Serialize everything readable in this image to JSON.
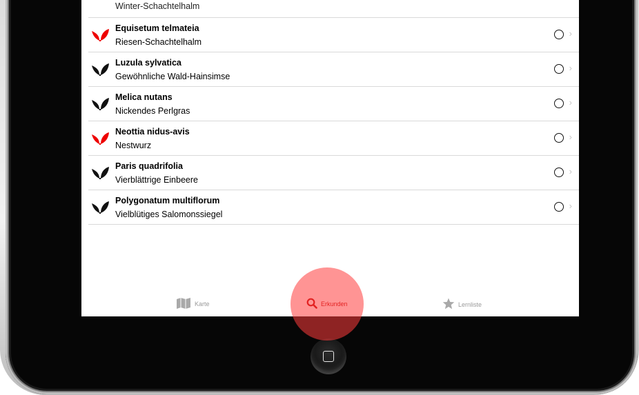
{
  "plant_list": [
    {
      "name": "",
      "common": "Winter-Schachtelhalm",
      "color": "#111111",
      "partial": true
    },
    {
      "name": "Equisetum telmateia",
      "common": "Riesen-Schachtelhalm",
      "color": "#ee0000"
    },
    {
      "name": "Luzula sylvatica",
      "common": "Gewöhnliche Wald-Hainsimse",
      "color": "#111111"
    },
    {
      "name": "Melica nutans",
      "common": "Nickendes Perlgras",
      "color": "#111111"
    },
    {
      "name": "Neottia nidus-avis",
      "common": "Nestwurz",
      "color": "#ee0000"
    },
    {
      "name": "Paris quadrifolia",
      "common": "Vierblättrige Einbeere",
      "color": "#111111"
    },
    {
      "name": "Polygonatum multiflorum",
      "common": "Vielblütiges Salomonssiegel",
      "color": "#111111"
    }
  ],
  "tabs": {
    "karte": {
      "label": "Karte",
      "icon": "map-icon"
    },
    "erkunden": {
      "label": "Erkunden",
      "icon": "search-icon",
      "active_color": "#c00000"
    },
    "lernliste": {
      "label": "Lernliste",
      "icon": "star-icon"
    }
  },
  "colors": {
    "accent": "#c00000",
    "touch_indicator": "#ff3c3c"
  }
}
